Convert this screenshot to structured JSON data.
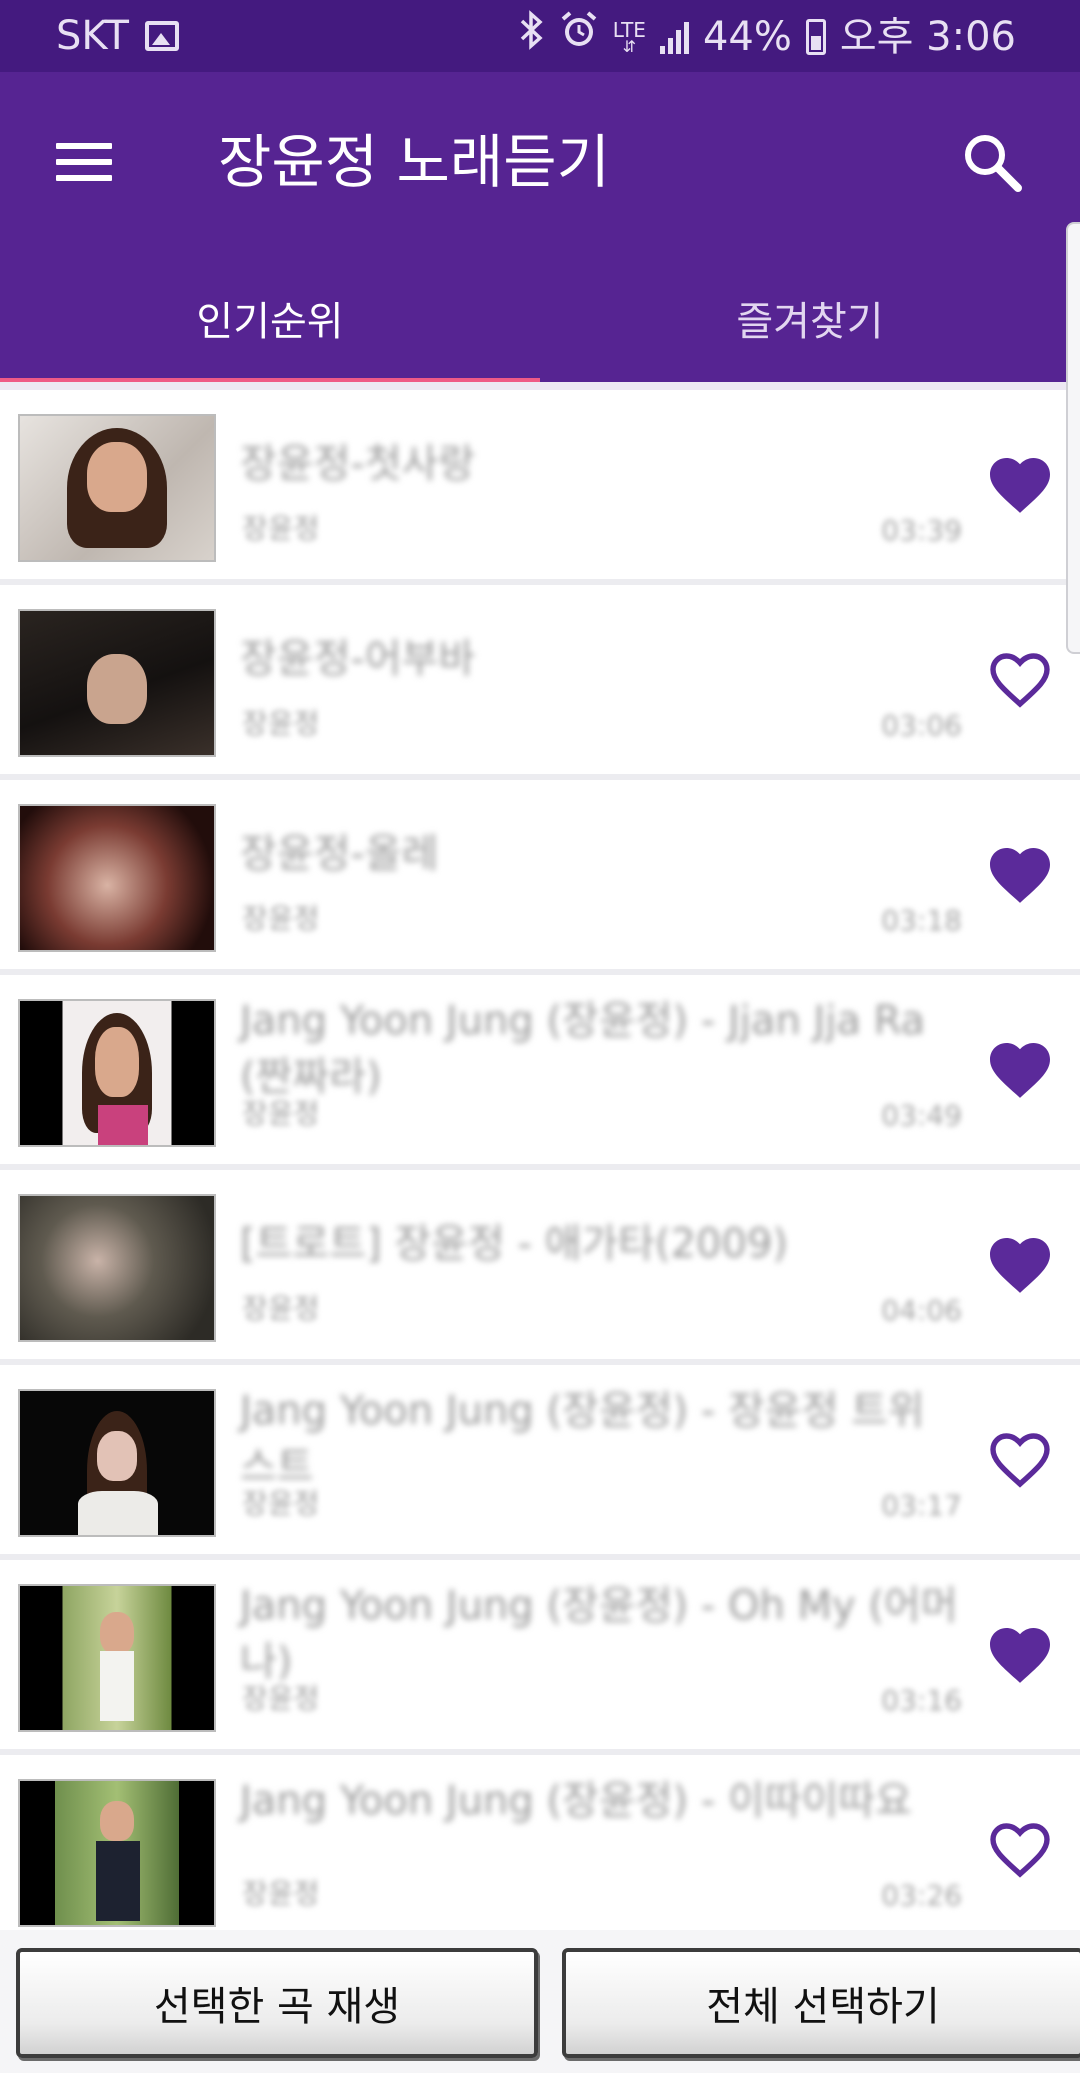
{
  "status_bar": {
    "carrier": "SKT",
    "lte_label": "LTE",
    "battery": "44%",
    "time": "오후 3:06",
    "icons": [
      "image-icon",
      "bluetooth-icon",
      "alarm-icon",
      "lte-icon",
      "signal-icon",
      "battery-icon"
    ]
  },
  "app_bar": {
    "title": "장윤정 노래듣기",
    "menu_icon": "hamburger-menu-icon",
    "search_icon": "search-icon",
    "color": "#562492",
    "status_color": "#441a7f"
  },
  "tabs": [
    {
      "label": "인기순위",
      "selected": true
    },
    {
      "label": "즐겨찾기",
      "selected": false
    }
  ],
  "accent": {
    "indicator": "#ef5a86",
    "heart": "#5b2a9a"
  },
  "songs": [
    {
      "title": "장윤정-첫사랑",
      "artist": "장윤정",
      "duration": "03:39",
      "favorite": true
    },
    {
      "title": "장윤정-어부바",
      "artist": "장윤정",
      "duration": "03:06",
      "favorite": false
    },
    {
      "title": "장윤정-올레",
      "artist": "장윤정",
      "duration": "03:18",
      "favorite": true
    },
    {
      "title": "Jang Yoon Jung (장윤정) - Jjan Jja Ra (짠짜라)",
      "artist": "장윤정",
      "duration": "03:49",
      "favorite": true
    },
    {
      "title": "[트로트] 장윤정 - 애가타(2009)",
      "artist": "장윤정",
      "duration": "04:06",
      "favorite": true
    },
    {
      "title": "Jang Yoon Jung (장윤정) - 장윤정 트위스트",
      "artist": "장윤정",
      "duration": "03:17",
      "favorite": false
    },
    {
      "title": "Jang Yoon Jung (장윤정) - Oh My (어머나)",
      "artist": "장윤정",
      "duration": "03:16",
      "favorite": true
    },
    {
      "title": "Jang Yoon Jung (장윤정) - 이따이따요",
      "artist": "장윤정",
      "duration": "03:26",
      "favorite": false
    }
  ],
  "bottom": {
    "play_selected": "선택한 곡 재생",
    "select_all": "전체 선택하기"
  }
}
